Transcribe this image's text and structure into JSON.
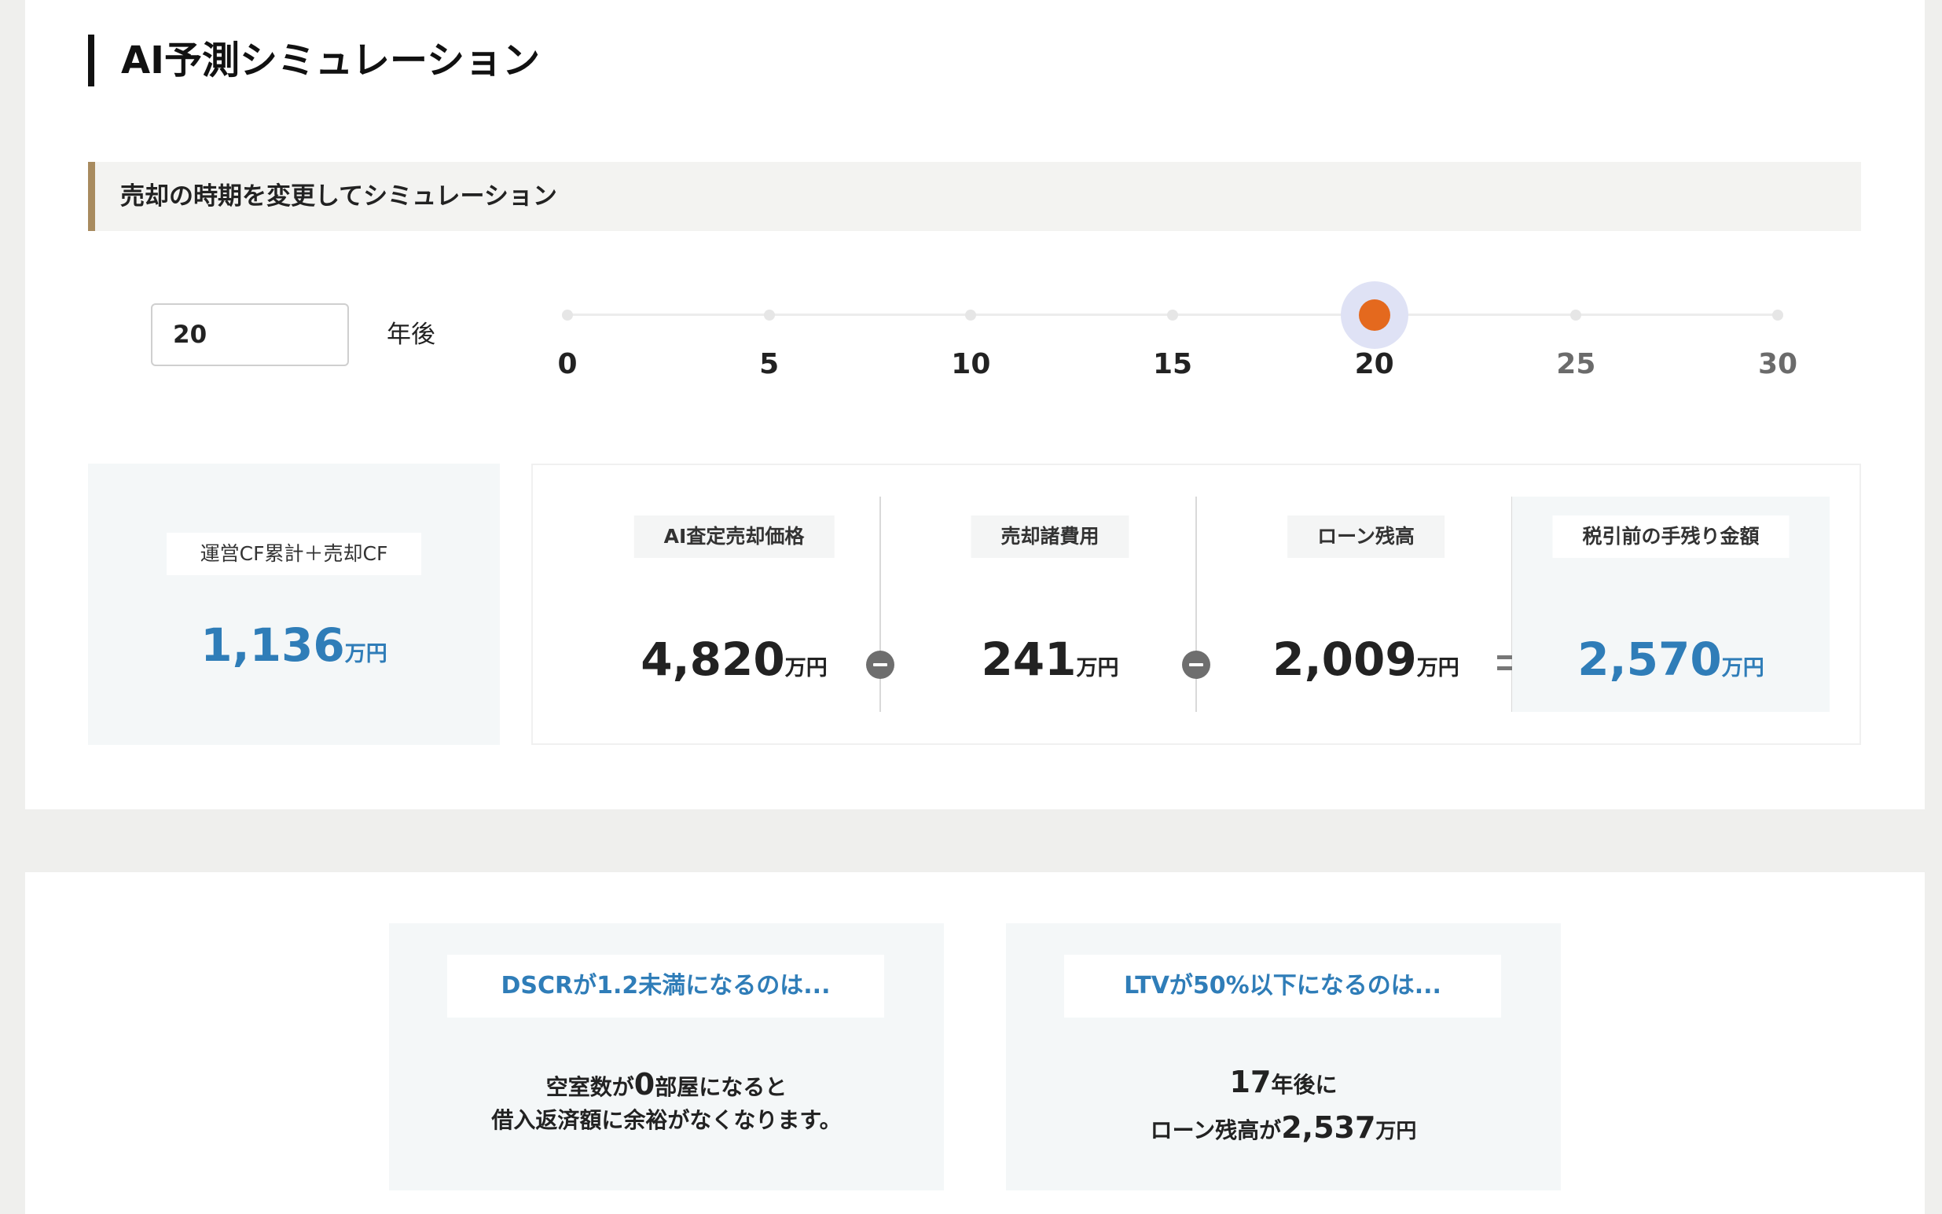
{
  "page_title": "AI予測シミュレーション",
  "section_header": "売却の時期を変更してシミュレーション",
  "year_input": {
    "value": "20",
    "unit": "年後"
  },
  "slider": {
    "ticks": [
      "0",
      "5",
      "10",
      "15",
      "20",
      "25",
      "30"
    ],
    "min": 0,
    "max": 30,
    "value": 20,
    "thumb_color": "#e4691e"
  },
  "summary": {
    "label": "運営CF累計＋売却CF",
    "value": "1,136",
    "unit": "万円"
  },
  "breakdown": [
    {
      "label": "AI査定売却価格",
      "value": "4,820",
      "unit": "万円"
    },
    {
      "label": "売却諸費用",
      "value": "241",
      "unit": "万円"
    },
    {
      "label": "ローン残高",
      "value": "2,009",
      "unit": "万円"
    },
    {
      "label": "税引前の手残り金額",
      "value": "2,570",
      "unit": "万円"
    }
  ],
  "dscr_card": {
    "title": "DSCRが1.2未満になるのは...",
    "line1_pre": "空室数が",
    "line1_num": "0",
    "line1_post": "部屋になると",
    "line2": "借入返済額に余裕がなくなります。"
  },
  "ltv_card": {
    "title": "LTVが50%以下になるのは...",
    "line1_num": "17",
    "line1_post": "年後に",
    "line2_pre": "ローン残高が",
    "line2_num": "2,537",
    "line2_unit": "万円"
  },
  "colors": {
    "accent_blue": "#2f7db8",
    "header_bar": "#a88b5f",
    "thumb": "#e4691e"
  }
}
